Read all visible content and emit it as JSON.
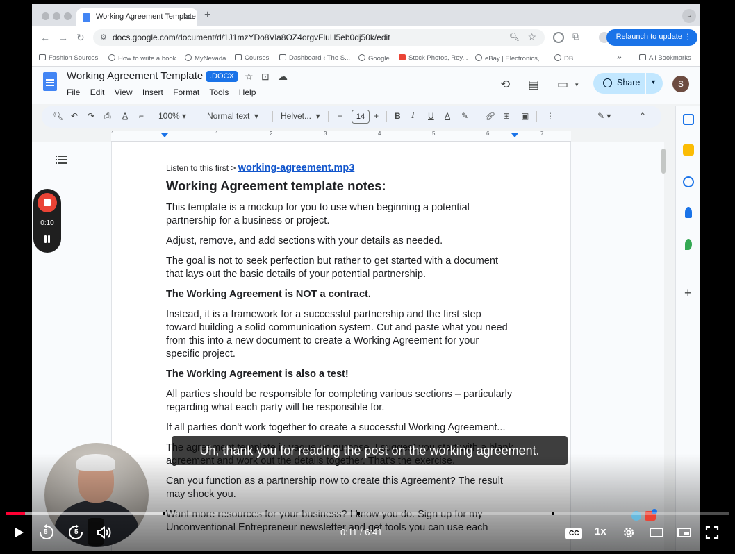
{
  "browser": {
    "tab_title": "Working Agreement Template",
    "url": "docs.google.com/document/d/1J1mzYDo8Vla8OZ4orgvFluH5eb0dj50k/edit",
    "relaunch_label": "Relaunch to update",
    "bookmarks": [
      "Fashion Sources",
      "How to write a book",
      "MyNevada",
      "Courses",
      "Dashboard ‹ The S...",
      "Google",
      "Stock Photos, Roy...",
      "eBay | Electronics,...",
      "DB"
    ],
    "more_bookmarks": "»",
    "all_bookmarks": "All Bookmarks"
  },
  "docs": {
    "title": "Working Agreement Template",
    "badge": ".DOCX",
    "menus": [
      "File",
      "Edit",
      "View",
      "Insert",
      "Format",
      "Tools",
      "Help"
    ],
    "share_label": "Share",
    "avatar_initial": "S",
    "toolbar": {
      "zoom": "100%",
      "style": "Normal text",
      "font": "Helvet...",
      "font_size": "14"
    },
    "ruler_numbers": [
      "1",
      "1",
      "2",
      "3",
      "4",
      "5",
      "6",
      "7"
    ]
  },
  "document": {
    "listen_prefix": "Listen to this first > ",
    "listen_link": "working-agreement.mp3",
    "heading": "Working Agreement template notes:",
    "paragraphs": [
      {
        "text": "This template is a mockup for you to use when beginning a potential partnership for a business or project.",
        "bold": false
      },
      {
        "text": " Adjust, remove, and add sections with your details as needed.",
        "bold": false
      },
      {
        "text": "The goal is not to seek perfection but rather to get started with a document that lays out the basic details of your potential partnership.",
        "bold": false
      },
      {
        "text": "The Working Agreement is NOT a contract.",
        "bold": true
      },
      {
        "text": "Instead, it is a framework for a successful partnership and the first step toward building a solid communication system. Cut and paste what you need from this into a new document to create a Working Agreement for your specific project.",
        "bold": false
      },
      {
        "text": "The Working Agreement is also a test!",
        "bold": true
      },
      {
        "text": "All parties should be responsible for completing various sections – particularly regarding what each party will be responsible for.",
        "bold": false
      },
      {
        "text": "If all parties don't work together to create a successful Working Agreement...",
        "bold": false
      },
      {
        "text": "The agreement template is vague on purpose. I suggest you start with a blank agreement and work out the details together. That's the exercise.",
        "bold": false
      },
      {
        "text": "Can you function as a partnership now to create this Agreement? The result may shock you.",
        "bold": false
      },
      {
        "text": "Want more resources for your business? I know you do. Sign up for my Unconventional Entrepreneur newsletter and get tools you can use each",
        "bold": false
      }
    ]
  },
  "recorder": {
    "elapsed": "0:10"
  },
  "video": {
    "caption": "Uh, thank you for reading the post on the working agreement.",
    "current_time": "0:11",
    "duration": "6:41",
    "played_fraction": 0.027,
    "buffered_fraction": 0.22,
    "speed": "1x",
    "cc_label": "CC",
    "skip_back_seconds": "5",
    "skip_forward_seconds": "5"
  },
  "colors": {
    "accent": "#1a73e8",
    "progress": "#ff0033",
    "record": "#ea4335",
    "share_bg": "#c2e7ff"
  }
}
